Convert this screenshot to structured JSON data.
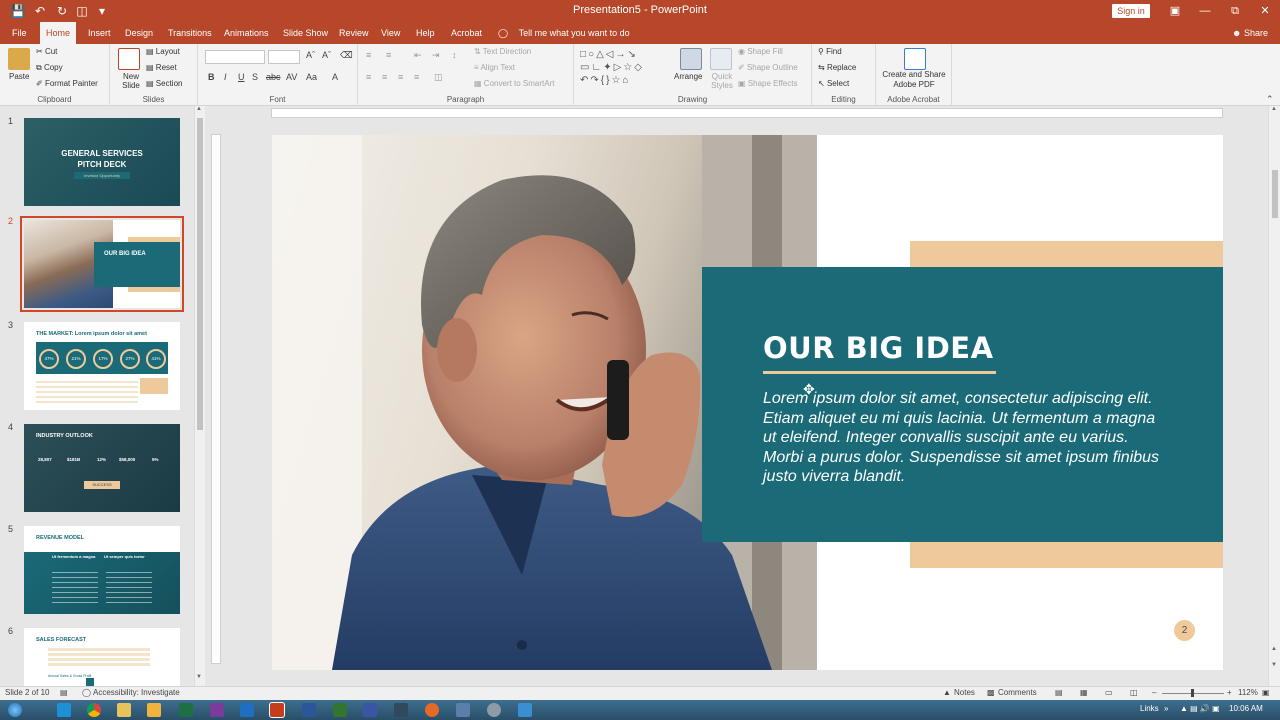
{
  "window": {
    "doc_title": "Presentation5  -  PowerPoint",
    "sign_in": "Sign in"
  },
  "tabs": [
    "File",
    "Home",
    "Insert",
    "Design",
    "Transitions",
    "Animations",
    "Slide Show",
    "Review",
    "View",
    "Help",
    "Acrobat"
  ],
  "active_tab": "Home",
  "tell_me": "Tell me what you want to do",
  "share": "Share",
  "ribbon": {
    "clipboard": {
      "label": "Clipboard",
      "paste": "Paste",
      "cut": "Cut",
      "copy": "Copy",
      "format_painter": "Format Painter"
    },
    "slides": {
      "label": "Slides",
      "new_slide": "New Slide",
      "layout": "Layout",
      "reset": "Reset",
      "section": "Section"
    },
    "font": {
      "label": "Font"
    },
    "paragraph": {
      "label": "Paragraph",
      "text_direction": "Text Direction",
      "align_text": "Align Text",
      "convert_smartart": "Convert to SmartArt"
    },
    "drawing": {
      "label": "Drawing",
      "arrange": "Arrange",
      "quick_styles": "Quick Styles",
      "shape_fill": "Shape Fill",
      "shape_outline": "Shape Outline",
      "shape_effects": "Shape Effects"
    },
    "editing": {
      "label": "Editing",
      "find": "Find",
      "replace": "Replace",
      "select": "Select"
    },
    "adobe": {
      "label": "Adobe Acrobat",
      "create_share": "Create and Share Adobe PDF"
    }
  },
  "thumbnails": [
    {
      "number": "1",
      "title": "GENERAL SERVICES PITCH DECK",
      "subtitle": "Investor Opportunity"
    },
    {
      "number": "2",
      "title": "OUR BIG IDEA"
    },
    {
      "number": "3",
      "title": "THE MARKET: Lorem ipsum dolor sit amet",
      "stats": [
        "47%",
        "21%",
        "17%",
        "27%",
        "41%"
      ]
    },
    {
      "number": "4",
      "title": "INDUSTRY OUTLOOK",
      "stats": [
        "28,807",
        "$181B",
        "12%",
        "$58,000",
        "5%"
      ],
      "badge": "SUCCESS"
    },
    {
      "number": "5",
      "title": "REVENUE MODEL",
      "col1": "Ut fermentum a magna",
      "col2": "Ut semper quis tortor"
    },
    {
      "number": "6",
      "title": "SALES FORECAST",
      "note": "Annual Sales & Gross Profit"
    }
  ],
  "slide": {
    "title": "OUR BIG IDEA",
    "body": "Lorem ipsum dolor sit amet, consectetur adipiscing elit. Etiam aliquet eu mi quis lacinia.  Ut fermentum a magna ut eleifend. Integer convallis suscipit ante eu varius. Morbi a purus dolor. Suspendisse sit amet ipsum finibus justo viverra blandit.",
    "page_number": "2"
  },
  "status": {
    "slide_of": "Slide 2 of 10",
    "accessibility": "Accessibility: Investigate",
    "notes": "Notes",
    "comments": "Comments",
    "zoom": "112%"
  },
  "taskbar": {
    "links": "Links",
    "time": "10:06 AM"
  },
  "colors": {
    "accent": "#b7472a",
    "teal": "#1a6a78",
    "tan": "#edc99c"
  }
}
